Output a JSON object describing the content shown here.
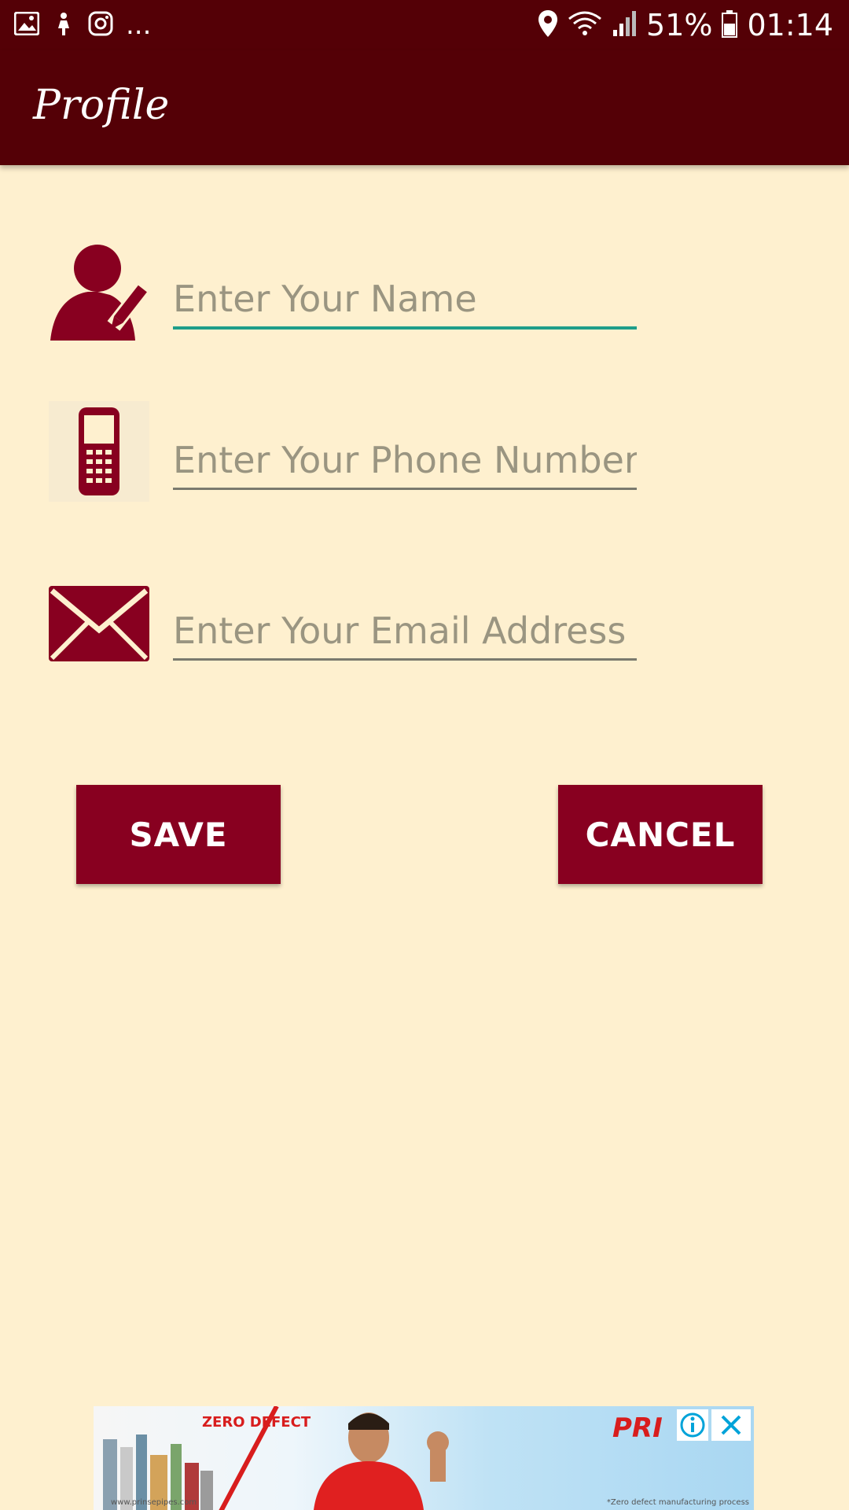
{
  "status_bar": {
    "battery_percent": "51%",
    "time": "01:14",
    "more_indicator": "..."
  },
  "app_bar": {
    "title": "Profile"
  },
  "form": {
    "name_field": {
      "placeholder": "Enter Your Name",
      "value": ""
    },
    "phone_field": {
      "placeholder": "Enter Your Phone Number",
      "value": ""
    },
    "email_field": {
      "placeholder": "Enter Your Email Address",
      "value": ""
    }
  },
  "buttons": {
    "save_label": "SAVE",
    "cancel_label": "CANCEL"
  },
  "ad": {
    "badge_text": "ZERO DEFECT",
    "brand_text": "PRI",
    "left_footer": "www.prinsepipes.com",
    "right_footer": "*Zero defect manufacturing process"
  },
  "colors": {
    "status_bar_bg": "#540006",
    "app_bar_bg": "#540006",
    "page_bg": "#FEF0CF",
    "accent_icon": "#880020",
    "button_bg": "#880020",
    "focused_underline": "#1E9E8A",
    "placeholder_text": "#9A9581"
  },
  "icons": {
    "status_left": [
      "image-icon",
      "touch-icon",
      "instagram-icon"
    ],
    "status_right": [
      "location-icon",
      "wifi-icon",
      "signal-icon",
      "battery-icon"
    ],
    "form": [
      "user-edit-icon",
      "phone-icon",
      "envelope-icon"
    ],
    "ad": [
      "adchoices-info-icon",
      "close-icon"
    ]
  }
}
